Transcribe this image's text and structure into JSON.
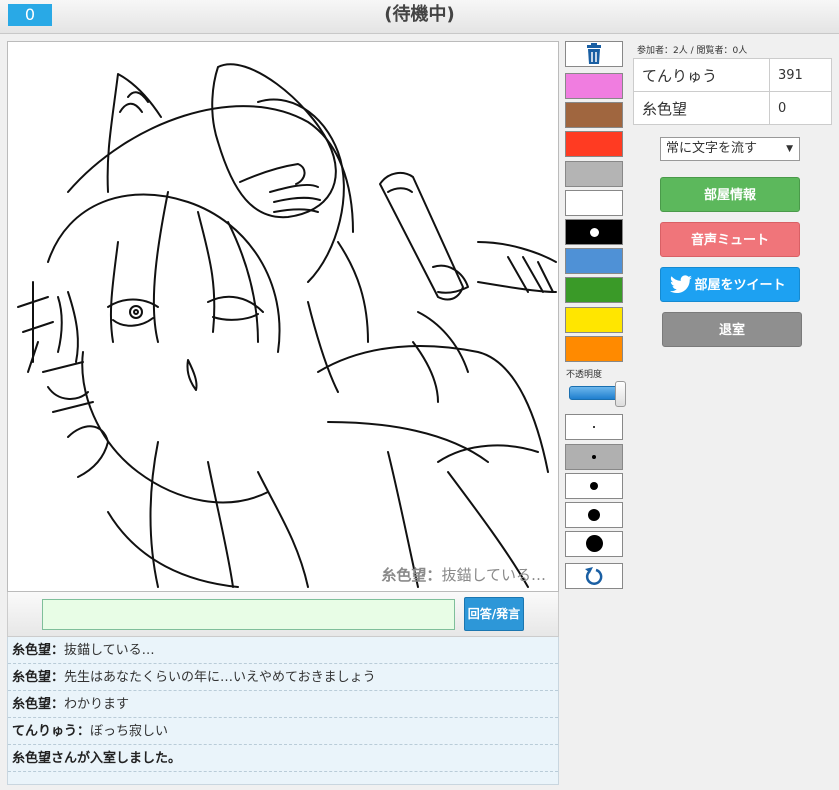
{
  "header": {
    "timer": "0",
    "status": "(待機中)"
  },
  "canvas": {
    "overlay_name": "糸色望：",
    "overlay_text": "抜錨している…"
  },
  "input": {
    "value": "",
    "submit_label": "回答/発言"
  },
  "chat": [
    {
      "name": "糸色望：",
      "text": "抜錨している…"
    },
    {
      "name": "糸色望：",
      "text": "先生はあなたくらいの年に…いえやめておきましょう"
    },
    {
      "name": "糸色望：",
      "text": "わかります"
    },
    {
      "name": "てんりゅう：",
      "text": "ぼっち寂しい"
    },
    {
      "name": "",
      "text": "糸色望さんが入室しました。"
    }
  ],
  "tools": {
    "trash_icon": "trash-icon",
    "colors": [
      "#f07de0",
      "#a0663f",
      "#ff3b22",
      "#b4b4b4",
      "#ffffff",
      "#000000",
      "#4f91d6",
      "#3a9a28",
      "#ffe600",
      "#ff8a00"
    ],
    "opacity_label": "不透明度",
    "opacity_level": 1.0,
    "undo_icon": "undo-icon"
  },
  "right_panel": {
    "counts": "参加者：2人 / 閲覧者：0人",
    "players": [
      {
        "name": "てんりゅう",
        "score": "391"
      },
      {
        "name": "糸色望",
        "score": "0"
      }
    ],
    "mode_select": "常に文字を流す",
    "buttons": {
      "room_info": "部屋情報",
      "mute": "音声ミュート",
      "tweet": "部屋をツイート",
      "exit": "退室"
    }
  },
  "colors": {
    "accent": "#29a9e6",
    "green": "#5cb85c",
    "pink": "#f0757a",
    "twitter": "#1da1f2",
    "gray": "#8f8f8f"
  }
}
